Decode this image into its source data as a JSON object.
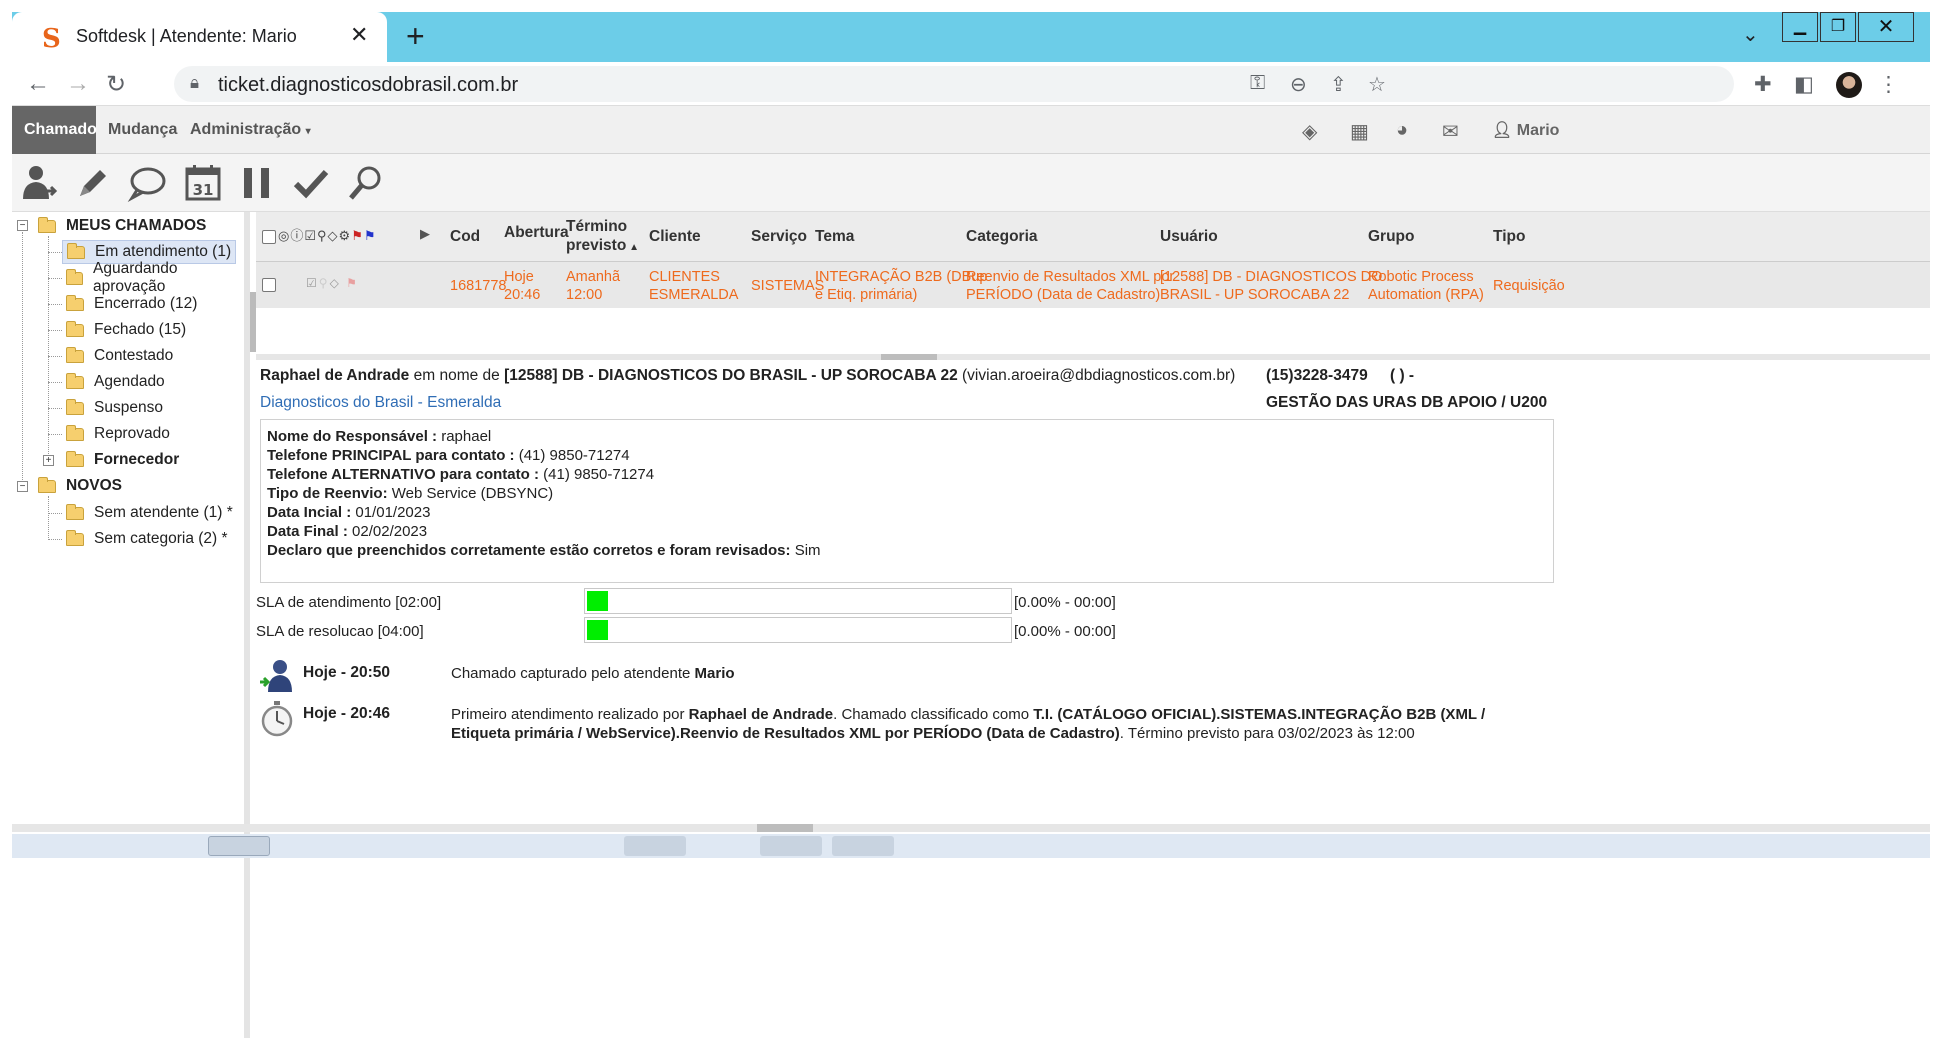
{
  "browser": {
    "tab_title": "Softdesk | Atendente: Mario",
    "favicon_letter": "S",
    "url": "ticket.diagnosticosdobrasil.com.br"
  },
  "appnav": {
    "tabs": [
      "Chamado",
      "Mudança",
      "Administração"
    ],
    "user": "Mario"
  },
  "tree": {
    "meus_chamados": "MEUS CHAMADOS",
    "items": [
      "Em atendimento (1)",
      "Aguardando aprovação",
      "Encerrado (12)",
      "Fechado (15)",
      "Contestado",
      "Agendado",
      "Suspenso",
      "Reprovado"
    ],
    "fornecedor": "Fornecedor",
    "novos": "NOVOS",
    "novos_items": [
      "Sem atendente (1) *",
      "Sem categoria (2) *"
    ]
  },
  "grid": {
    "headers": {
      "cod": "Cod",
      "abertura": "Abertura",
      "termino1": "Término",
      "termino2": "previsto",
      "cliente": "Cliente",
      "servico": "Serviço",
      "tema": "Tema",
      "categoria": "Categoria",
      "usuario": "Usuário",
      "grupo": "Grupo",
      "tipo": "Tipo"
    },
    "row": {
      "cod": "1681778",
      "abertura1": "Hoje",
      "abertura2": "20:46",
      "termino1": "Amanhã",
      "termino2": "12:00",
      "cliente1": "CLIENTES",
      "cliente2": "ESMERALDA",
      "servico": "SISTEMAS",
      "tema1": "INTEGRAÇÃO B2B (DBup",
      "tema2": "e Etiq. primária)",
      "categoria1": "Reenvio de Resultados XML por",
      "categoria2": "PERÍODO (Data de Cadastro)",
      "usuario1": "[12588] DB - DIAGNOSTICOS DO",
      "usuario2": "BRASIL - UP SOROCABA 22",
      "grupo1": "Robotic Process",
      "grupo2": "Automation (RPA)",
      "tipo": "Requisição"
    }
  },
  "detail": {
    "requester": "Raphael de Andrade",
    "em_nome_de": "em nome de",
    "org": "[12588] DB - DIAGNOSTICOS DO BRASIL - UP SOROCABA 22",
    "email": "(vivian.aroeira@dbdiagnosticos.com.br)",
    "phone": "(15)3228-3479",
    "phone_ext": "( ) -",
    "client_link": "Diagnosticos do Brasil - Esmeralda",
    "dept": "GESTÃO DAS URAS DB APOIO / U200",
    "form": [
      {
        "label": "Nome do Responsável :",
        "value": "raphael"
      },
      {
        "label": "Telefone PRINCIPAL para contato :",
        "value": "(41) 9850-71274"
      },
      {
        "label": "Telefone ALTERNATIVO para contato :",
        "value": "(41) 9850-71274"
      },
      {
        "label": "Tipo de Reenvio:",
        "value": "Web Service (DBSYNC)"
      },
      {
        "label": "Data Incial :",
        "value": "01/01/2023"
      },
      {
        "label": "Data Final :",
        "value": "02/02/2023"
      },
      {
        "label": "Declaro que preenchidos corretamente estão corretos e foram revisados:",
        "value": "Sim"
      }
    ]
  },
  "sla": [
    {
      "label": "SLA de atendimento [02:00]",
      "value": "[0.00% - 00:00]",
      "fill_fraction": 0.05
    },
    {
      "label": "SLA de resolucao [04:00]",
      "value": "[0.00% - 00:00]",
      "fill_fraction": 0.05
    }
  ],
  "history": [
    {
      "time": "Hoje - 20:50",
      "text": "Chamado capturado pelo atendente",
      "bold": "Mario"
    },
    {
      "time": "Hoje - 20:46",
      "p1": "Primeiro atendimento realizado por",
      "b1": "Raphael de Andrade",
      "p2": ". Chamado classificado como",
      "b2": "T.I. (CATÁLOGO OFICIAL).SISTEMAS.INTEGRAÇÃO B2B (XML / Etiqueta primária / WebService).Reenvio de Resultados XML por PERÍODO (Data de Cadastro)",
      "p3": ". Término previsto para 03/02/2023 às 12:00"
    }
  ],
  "colors": {
    "browser_tabbar": "#6ccde8",
    "row_text": "#ee6a1d",
    "sla_green": "#00ee00",
    "link": "#2f6db5"
  }
}
